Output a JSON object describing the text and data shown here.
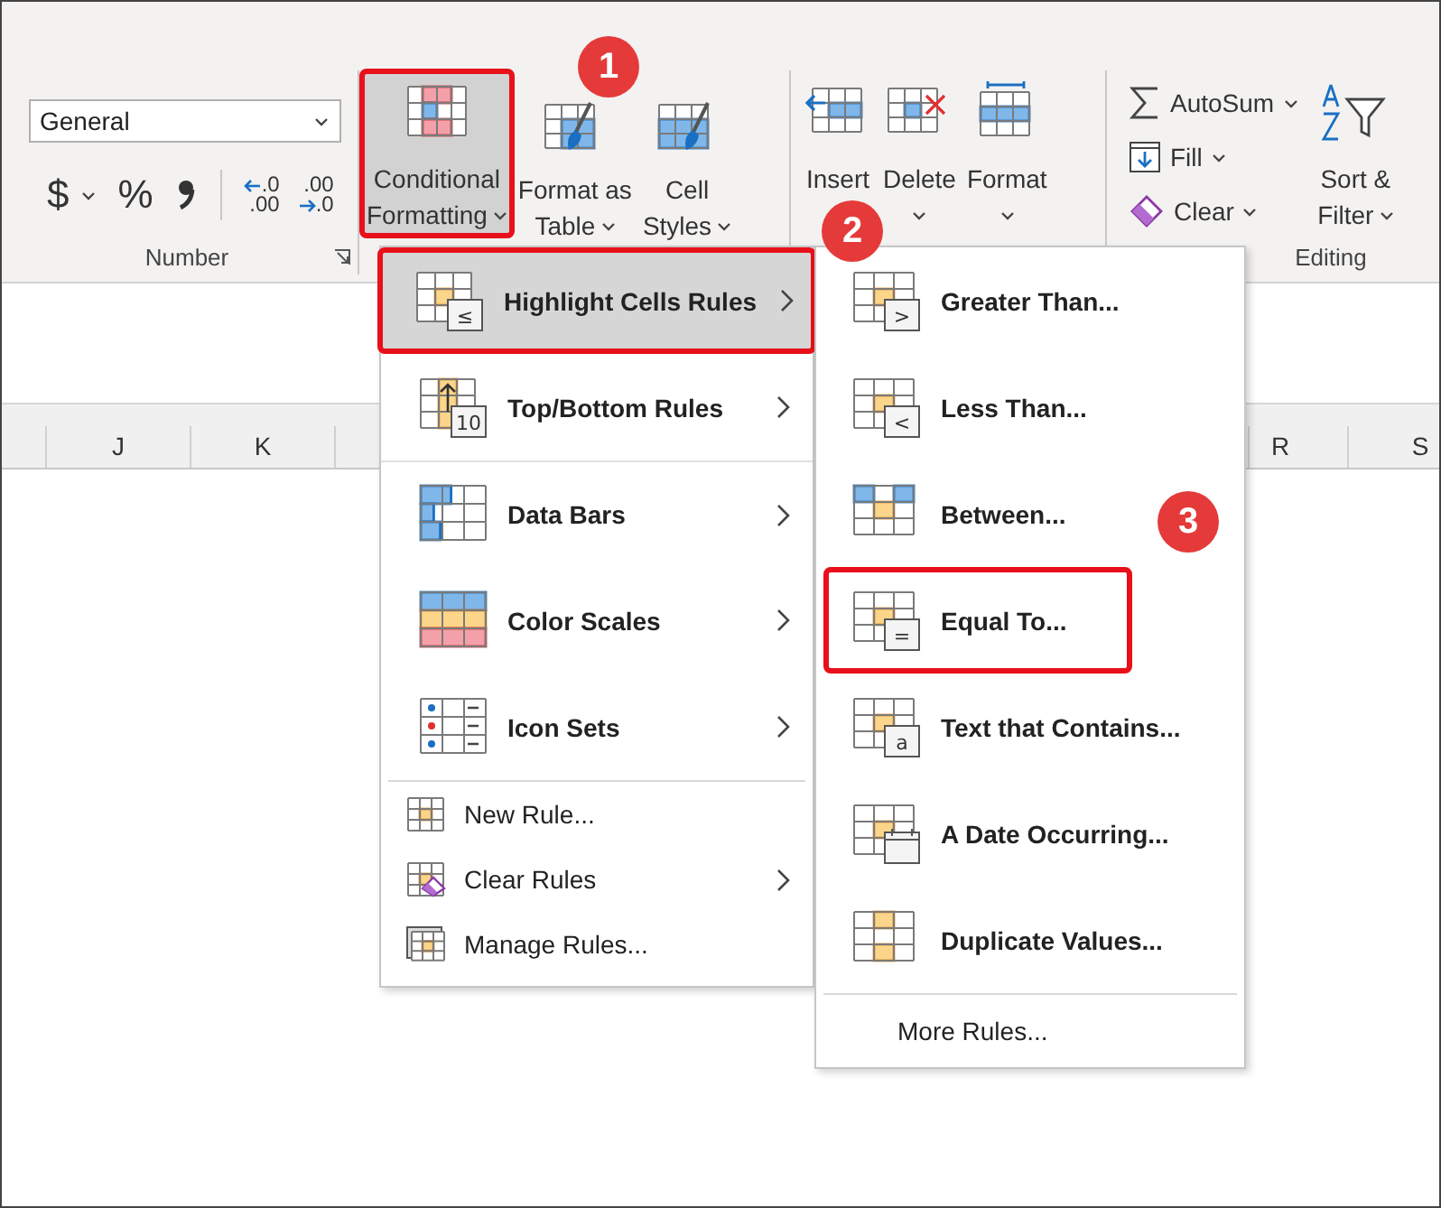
{
  "ribbon": {
    "number_group": {
      "label": "Number",
      "format_box": {
        "value": "General"
      },
      "currency": "$",
      "percent": "%",
      "decimals": [
        {
          "kind": "increase",
          "top": ".0",
          "bottom": ".00"
        },
        {
          "kind": "decrease",
          "top": ".00",
          "bottom": ".0"
        }
      ]
    },
    "style_buttons": [
      {
        "kind": "conditional",
        "lines": [
          "Conditional",
          "Formatting"
        ],
        "selected": true,
        "emphasized": true
      },
      {
        "kind": "table",
        "lines": [
          "Format as",
          "Table"
        ],
        "selected": false,
        "emphasized": false
      },
      {
        "kind": "styles",
        "lines": [
          "Cell",
          "Styles"
        ],
        "selected": false,
        "emphasized": false
      }
    ],
    "cell_buttons": [
      {
        "kind": "insert",
        "label": "Insert",
        "dropdown": false
      },
      {
        "kind": "delete",
        "label": "Delete",
        "dropdown": true
      },
      {
        "kind": "format",
        "label": "Format",
        "dropdown": true
      }
    ],
    "editing_group": {
      "label": "Editing",
      "commands": [
        {
          "kind": "autosum",
          "label": "AutoSum"
        },
        {
          "kind": "fill",
          "label": "Fill"
        },
        {
          "kind": "clear",
          "label": "Clear"
        }
      ],
      "sort": {
        "lines": [
          "Sort &",
          "Filter"
        ]
      }
    }
  },
  "columns": {
    "left": [
      "J",
      "K"
    ],
    "right": [
      "R",
      "S"
    ]
  },
  "conditional_menu": {
    "rule_types": [
      {
        "kind": "highlight",
        "label": "Highlight Cells Rules",
        "badge": "≤",
        "selected": true,
        "emphasized": true
      },
      {
        "kind": "topbottom",
        "label": "Top/Bottom Rules",
        "badge": "10",
        "selected": false,
        "emphasized": false
      },
      {
        "kind": "databars",
        "label": "Data Bars",
        "selected": false,
        "emphasized": false
      },
      {
        "kind": "colorscales",
        "label": "Color Scales",
        "selected": false,
        "emphasized": false
      },
      {
        "kind": "iconsets",
        "label": "Icon Sets",
        "selected": false,
        "emphasized": false
      }
    ],
    "actions": [
      {
        "kind": "newrule",
        "label": "New Rule...",
        "submenu": false
      },
      {
        "kind": "clearrules",
        "label": "Clear Rules",
        "submenu": true
      },
      {
        "kind": "managerules",
        "label": "Manage Rules...",
        "submenu": false
      }
    ]
  },
  "highlight_submenu": {
    "items": [
      {
        "kind": "badge",
        "label": "Greater Than...",
        "badge": ">",
        "emphasized": false
      },
      {
        "kind": "badge",
        "label": "Less Than...",
        "badge": "<",
        "emphasized": false
      },
      {
        "kind": "between",
        "label": "Between...",
        "emphasized": false
      },
      {
        "kind": "badge",
        "label": "Equal To...",
        "badge": "=",
        "emphasized": true
      },
      {
        "kind": "badge",
        "label": "Text that Contains...",
        "badge": "a",
        "emphasized": false
      },
      {
        "kind": "date",
        "label": "A Date Occurring...",
        "emphasized": false
      },
      {
        "kind": "duplicate",
        "label": "Duplicate Values...",
        "emphasized": false
      }
    ],
    "more": {
      "label": "More Rules..."
    }
  },
  "callouts": [
    {
      "number": "1"
    },
    {
      "number": "2"
    },
    {
      "number": "3"
    }
  ]
}
